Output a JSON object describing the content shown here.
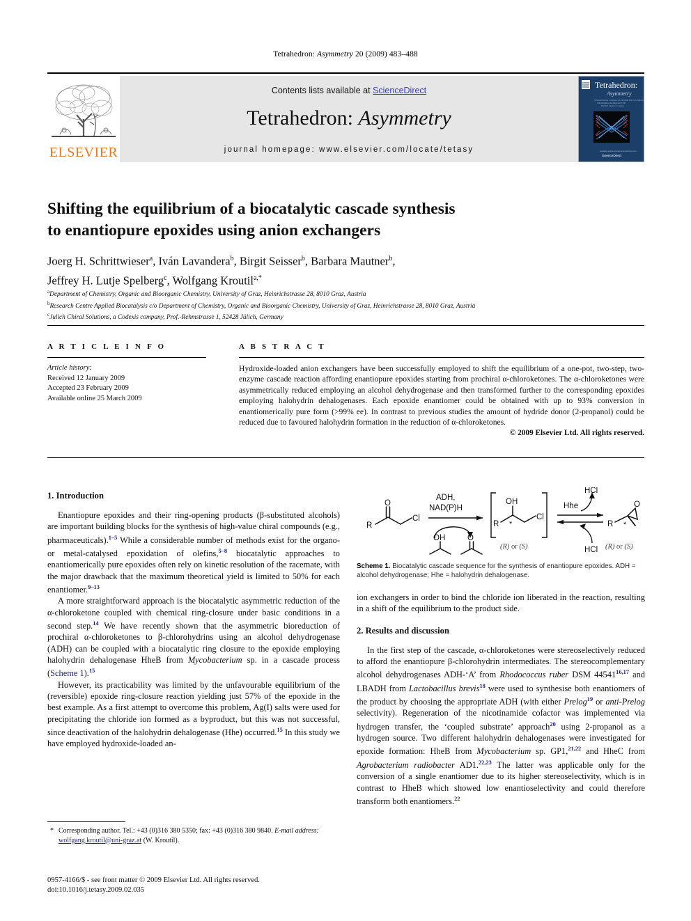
{
  "running_head": {
    "prefix": "Tetrahedron: ",
    "italic": "Asymmetry",
    "suffix": " 20 (2009) 483–488"
  },
  "masthead": {
    "contents_prefix": "Contents lists available at ",
    "sciencedirect": "ScienceDirect",
    "journal_title_main": "Tetrahedron: ",
    "journal_title_italic": "Asymmetry",
    "homepage": "journal homepage: www.elsevier.com/locate/tetasy",
    "publisher": "ELSEVIER",
    "cover_title_main": "Tetrahedron:",
    "cover_title_sub": "Asymmetry",
    "cover_footer": "ScienceDirect",
    "accent_link": "#3a3ad0",
    "elsevier_orange": "#E87722",
    "band_bg": "#e6e6e6"
  },
  "article": {
    "title_line1": "Shifting the equilibrium of a biocatalytic cascade synthesis",
    "title_line2": "to enantiopure epoxides using anion exchangers",
    "authors_line1_parts": [
      {
        "name": "Joerg H. Schrittwieser",
        "sup": "a"
      },
      {
        "name": "Iván Lavandera",
        "sup": "b"
      },
      {
        "name": "Birgit Seisser",
        "sup": "b"
      },
      {
        "name": "Barbara Mautner",
        "sup": "b"
      }
    ],
    "authors_line2_parts": [
      {
        "name": "Jeffrey H. Lutje Spelberg",
        "sup": "c"
      },
      {
        "name": "Wolfgang Kroutil",
        "sup": "a,*"
      }
    ],
    "affiliations": [
      {
        "sup": "a",
        "text": "Department of Chemistry, Organic and Bioorganic Chemistry, University of Graz, Heinrichstrasse 28, 8010 Graz, Austria"
      },
      {
        "sup": "b",
        "text": "Research Centre Applied Biocatalysis c/o Department of Chemistry, Organic and Bioorganic Chemistry, University of Graz, Heinrichstrasse 28, 8010 Graz, Austria"
      },
      {
        "sup": "c",
        "text": "Julich Chiral Solutions, a Codexis company, Prof.-Rehmstrasse 1, 52428 Jülich, Germany"
      }
    ]
  },
  "article_info": {
    "heading": "A R T I C L E   I N F O",
    "history_label": "Article history:",
    "history": [
      "Received 12 January 2009",
      "Accepted 23 February 2009",
      "Available online 25 March 2009"
    ]
  },
  "abstract": {
    "heading": "A B S T R A C T",
    "body": "Hydroxide-loaded anion exchangers have been successfully employed to shift the equilibrium of a one-pot, two-step, two-enzyme cascade reaction affording enantiopure epoxides starting from prochiral α-chloroketones. The α-chloroketones were asymmetrically reduced employing an alcohol dehydrogenase and then transformed further to the corresponding epoxides employing halohydrin dehalogenases. Each epoxide enantiomer could be obtained with up to 93% conversion in enantiomerically pure form (>99% ee). In contrast to previous studies the amount of hydride donor (2-propanol) could be reduced due to favoured halohydrin formation in the reduction of α-chloroketones.",
    "copyright": "© 2009 Elsevier Ltd. All rights reserved."
  },
  "sections": {
    "intro_heading": "1. Introduction",
    "results_heading": "2. Results and discussion"
  },
  "paragraphs": {
    "intro_p1_a": "Enantiopure epoxides and their ring-opening products (β-substituted alcohols) are important building blocks for the synthesis of high-value chiral compounds (e.g., pharmaceuticals).",
    "intro_p1_ref1": "1–5",
    "intro_p1_b": " While a considerable number of methods exist for the organo- or metal-catalysed epoxidation of olefins,",
    "intro_p1_ref2": "5–8",
    "intro_p1_c": " biocatalytic approaches to enantiomerically pure epoxides often rely on kinetic resolution of the racemate, with the major drawback that the maximum theoretical yield is limited to 50% for each enantiomer.",
    "intro_p1_ref3": "9–13",
    "intro_p2_a": "A more straightforward approach is the biocatalytic asymmetric reduction of the α-chloroketone coupled with chemical ring-closure under basic conditions in a second step.",
    "intro_p2_ref1": "14",
    "intro_p2_b": " We have recently shown that the asymmetric bioreduction of prochiral α-chloroketones to β-chlorohydrins using an alcohol dehydrogenase (ADH) can be coupled with a biocatalytic ring closure to the epoxide employing halohydrin dehalogenase HheB from ",
    "intro_p2_it1": "Mycobacterium",
    "intro_p2_c": " sp. in a cascade process (",
    "intro_p2_link": "Scheme 1",
    "intro_p2_d": ").",
    "intro_p2_ref2": "15",
    "intro_p3_a": "However, its practicability was limited by the unfavourable equilibrium of the (reversible) epoxide ring-closure reaction yielding just 57% of the epoxide in the best example. As a first attempt to overcome this problem, Ag(I) salts were used for precipitating the chloride ion formed as a byproduct, but this was not successful, since deactivation of the halohydrin dehalogenase (Hhe) occurred.",
    "intro_p3_ref1": "15",
    "intro_p3_b": " In this study we have employed hydroxide-loaded an-",
    "right_p1": "ion exchangers in order to bind the chloride ion liberated in the reaction, resulting in a shift of the equilibrium to the product side.",
    "results_p1_a": "In the first step of the cascade, α-chloroketones were stereoselectively reduced to afford the enantiopure β-chlorohydrin intermediates. The stereocomplementary alcohol dehydrogenases ADH-‘A’ from ",
    "results_p1_it1": "Rhodococcus ruber",
    "results_p1_b": " DSM 44541",
    "results_p1_ref1": "16,17",
    "results_p1_c": " and LBADH from ",
    "results_p1_it2": "Lactobacillus brevis",
    "results_p1_ref2": "18",
    "results_p1_d": " were used to synthesise both enantiomers of the product by choosing the appropriate ADH (with either ",
    "results_p1_it3": "Prelog",
    "results_p1_ref3": "19",
    "results_p1_e": " or ",
    "results_p1_it4": "anti-Prelog",
    "results_p1_f": " selectivity). Regeneration of the nicotinamide cofactor was implemented via hydrogen transfer, the ‘coupled substrate’ approach",
    "results_p1_ref4": "20",
    "results_p1_g": " using 2-propanol as a hydrogen source. Two different halohydrin dehalogenases were investigated for epoxide formation: HheB from ",
    "results_p1_it5": "Mycobacterium",
    "results_p1_h": " sp. GP1,",
    "results_p1_ref5": "21,22",
    "results_p1_i": " and HheC from ",
    "results_p1_it6": "Agrobacterium radiobacter",
    "results_p1_j": " AD1.",
    "results_p1_ref6": "22,23",
    "results_p1_k": " The latter was applicable only for the conversion of a single enantiomer due to its higher stereoselectivity, which is in contrast to HheB which showed low enantioselectivity and could therefore transform both enantiomers.",
    "results_p1_ref7": "22"
  },
  "scheme": {
    "caption_bold": "Scheme 1.",
    "caption_text": " Biocatalytic cascade sequence for the synthesis of enantiopure epoxides. ADH = alcohol dehydrogenase; Hhe = halohydrin dehalogenase.",
    "labels": {
      "R1": "R",
      "O_ketone": "O",
      "Cl1": "Cl",
      "enzyme_top1": "ADH,",
      "enzyme_top2": "NAD(P)H",
      "cofactor_oh": "OH",
      "cofactor_o": "O",
      "OH_int": "OH",
      "R2": "R",
      "star1": "*",
      "Cl2": "Cl",
      "stereo1": "(R) or (S)",
      "hhe": "Hhe",
      "hcl_top": "HCl",
      "hcl_bottom": "HCl",
      "O_epoxide": "O",
      "R3": "R",
      "star2": "*",
      "stereo2": "(R) or (S)"
    }
  },
  "footnote": {
    "star": "*",
    "line1": "Corresponding author. Tel.: +43 (0)316 380 5350; fax: +43 (0)316 380 9840.",
    "email_label": "E-mail address:",
    "email": "wolfgang.kroutil@uni-graz.at",
    "email_suffix": " (W. Kroutil)."
  },
  "issn": {
    "line1": "0957-4166/$ - see front matter © 2009 Elsevier Ltd. All rights reserved.",
    "line2": "doi:10.1016/j.tetasy.2009.02.035"
  }
}
